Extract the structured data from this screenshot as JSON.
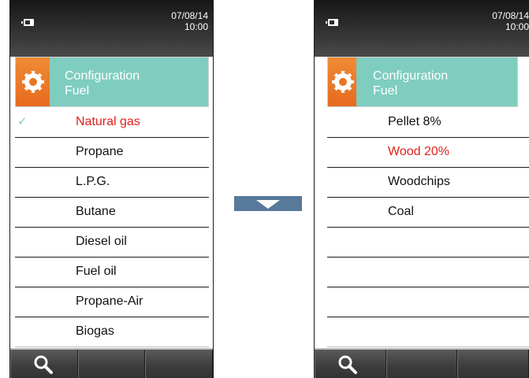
{
  "screens": [
    {
      "status": {
        "date": "07/08/14",
        "time": "10:00"
      },
      "header": {
        "title": "Configuration",
        "subtitle": "Fuel"
      },
      "items": [
        {
          "label": "Natural gas",
          "selected": true,
          "checked": true
        },
        {
          "label": "Propane"
        },
        {
          "label": "L.P.G."
        },
        {
          "label": "Butane"
        },
        {
          "label": "Diesel oil"
        },
        {
          "label": "Fuel oil"
        },
        {
          "label": "Propane-Air"
        },
        {
          "label": "Biogas"
        }
      ]
    },
    {
      "status": {
        "date": "07/08/14",
        "time": "10:00"
      },
      "header": {
        "title": "Configuration",
        "subtitle": "Fuel"
      },
      "items": [
        {
          "label": "Pellet 8%"
        },
        {
          "label": "Wood 20%",
          "selected": true
        },
        {
          "label": "Woodchips"
        },
        {
          "label": "Coal"
        },
        {
          "label": ""
        },
        {
          "label": ""
        },
        {
          "label": ""
        },
        {
          "label": ""
        }
      ]
    }
  ],
  "icons": {
    "battery": "battery-icon",
    "gear": "gear-icon",
    "check": "check-icon",
    "search": "search-icon",
    "down_arrow": "down-arrow-icon"
  },
  "colors": {
    "header_accent": "#7fcdbf",
    "gear_tile": "#e8761f",
    "selected_text": "#e0201b",
    "arrow_button": "#57799a"
  }
}
